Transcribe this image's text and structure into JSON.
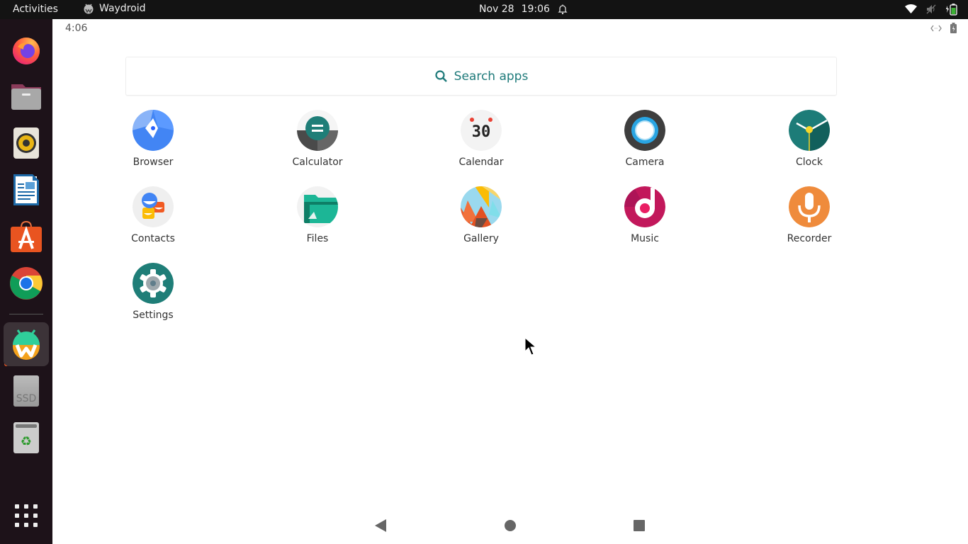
{
  "topbar": {
    "activities": "Activities",
    "app_name": "Waydroid",
    "date": "Nov 28",
    "time": "19:06",
    "icons": [
      "alarm-bell-icon",
      "wifi-icon",
      "volume-muted-icon",
      "battery-charging-icon"
    ]
  },
  "dock": {
    "items": [
      {
        "name": "firefox",
        "icon": "firefox-icon"
      },
      {
        "name": "files",
        "icon": "folder-icon"
      },
      {
        "name": "rhythmbox",
        "icon": "speaker-icon"
      },
      {
        "name": "libreoffice-writer",
        "icon": "document-icon"
      },
      {
        "name": "ubuntu-software",
        "icon": "shopping-bag-icon"
      },
      {
        "name": "chrome",
        "icon": "chrome-icon"
      },
      {
        "name": "waydroid",
        "icon": "waydroid-icon",
        "active": true
      },
      {
        "name": "ssd-drive",
        "icon": "drive-icon",
        "label": "SSD"
      },
      {
        "name": "trash",
        "icon": "trash-icon"
      },
      {
        "name": "show-applications",
        "icon": "app-grid-icon"
      }
    ]
  },
  "android": {
    "status_time": "4:06",
    "status_icons": [
      "resize-icon",
      "battery-icon"
    ],
    "search_placeholder": "Search apps",
    "apps": [
      {
        "label": "Browser"
      },
      {
        "label": "Calculator"
      },
      {
        "label": "Calendar",
        "badge_text": "30"
      },
      {
        "label": "Camera"
      },
      {
        "label": "Clock"
      },
      {
        "label": "Contacts"
      },
      {
        "label": "Files"
      },
      {
        "label": "Gallery"
      },
      {
        "label": "Music"
      },
      {
        "label": "Recorder"
      },
      {
        "label": "Settings"
      }
    ],
    "nav": [
      "back",
      "home",
      "recents"
    ]
  },
  "colors": {
    "accent_teal": "#1e7a7a",
    "ubuntu_orange": "#e95420"
  }
}
